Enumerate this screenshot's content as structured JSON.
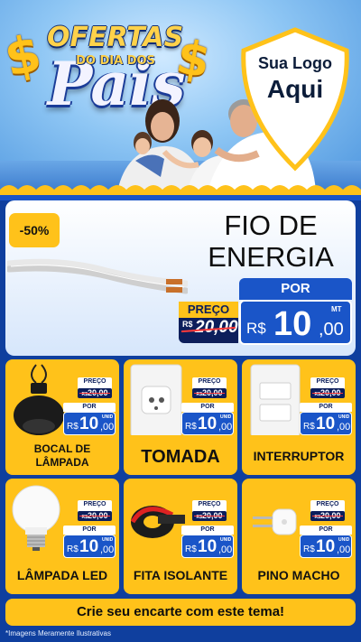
{
  "hero": {
    "dollar_symbol": "$",
    "ofertas": "OFERTAS",
    "do_dia_dos": "DO DIA DOS",
    "pais": "Pais",
    "logo_line1": "Sua Logo",
    "logo_line2": "Aqui"
  },
  "main_product": {
    "discount": "-50%",
    "title_line1": "FIO DE",
    "title_line2": "ENERGIA",
    "por_label": "POR",
    "preco_label": "PREÇO",
    "old_currency": "R$",
    "old_price": "20,00",
    "currency": "R$",
    "price_int": "10",
    "price_dec": ",00",
    "unit": "MT"
  },
  "products": [
    {
      "name_line1": "BOCAL DE",
      "name_line2": "LÂMPADA",
      "preco_label": "PREÇO",
      "old_currency": "R$",
      "old_price": "20,00",
      "por_label": "POR",
      "currency": "R$",
      "price_int": "10",
      "price_dec": ",00",
      "unit": "UNID",
      "icon": "lamp-socket-icon"
    },
    {
      "name_line1": "TOMADA",
      "name_line2": "",
      "preco_label": "PREÇO",
      "old_currency": "R$",
      "old_price": "20,00",
      "por_label": "POR",
      "currency": "R$",
      "price_int": "10",
      "price_dec": ",00",
      "unit": "UNID",
      "icon": "outlet-icon"
    },
    {
      "name_line1": "INTERRUPTOR",
      "name_line2": "",
      "preco_label": "PREÇO",
      "old_currency": "R$",
      "old_price": "20,00",
      "por_label": "POR",
      "currency": "R$",
      "price_int": "10",
      "price_dec": ",00",
      "unit": "UNID",
      "icon": "switch-icon"
    },
    {
      "name_line1": "LÂMPADA LED",
      "name_line2": "",
      "preco_label": "PREÇO",
      "old_currency": "R$",
      "old_price": "20,00",
      "por_label": "POR",
      "currency": "R$",
      "price_int": "10",
      "price_dec": ",00",
      "unit": "UNID",
      "icon": "led-bulb-icon"
    },
    {
      "name_line1": "FITA ISOLANTE",
      "name_line2": "",
      "preco_label": "PREÇO",
      "old_currency": "R$",
      "old_price": "20,00",
      "por_label": "POR",
      "currency": "R$",
      "price_int": "10",
      "price_dec": ",00",
      "unit": "UNID",
      "icon": "electrical-tape-icon"
    },
    {
      "name_line1": "PINO MACHO",
      "name_line2": "",
      "preco_label": "PREÇO",
      "old_currency": "R$",
      "old_price": "20,00",
      "por_label": "POR",
      "currency": "R$",
      "price_int": "10",
      "price_dec": ",00",
      "unit": "UNID",
      "icon": "plug-icon"
    }
  ],
  "footer": {
    "cta": "Crie seu encarte com este tema!",
    "disclaimer": "*Imagens Meramente Ilustrativas"
  },
  "colors": {
    "brand_blue": "#1a55c8",
    "dark_navy": "#0c1e5b",
    "accent_yellow": "#ffc21a",
    "strike_red": "#ff3a3a"
  }
}
